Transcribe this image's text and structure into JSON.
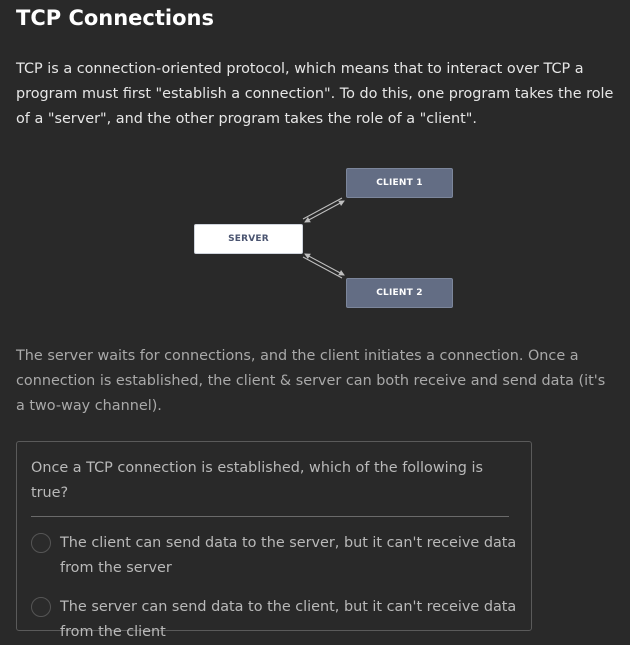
{
  "page": {
    "title": "TCP Connections",
    "intro": "TCP is a connection-oriented protocol, which means that to interact over TCP a program must first \"establish a connection\". To do this, one program takes the role of a \"server\", and the other program takes the role of a \"client\".",
    "after": "The server waits for connections, and the client initiates a connection. Once a connection is established, the client & server can both receive and send data (it's a two-way channel)."
  },
  "diagram": {
    "server": "SERVER",
    "client1": "CLIENT 1",
    "client2": "CLIENT 2"
  },
  "quiz": {
    "question": "Once a TCP connection is established, which of the following is true?",
    "options": [
      "The client can send data to the server, but it can't receive data from the server",
      "The server can send data to the client, but it can't receive data from the client"
    ]
  },
  "colors": {
    "background": "#292929",
    "client_node": "#636d84",
    "server_node": "#ffffff"
  }
}
